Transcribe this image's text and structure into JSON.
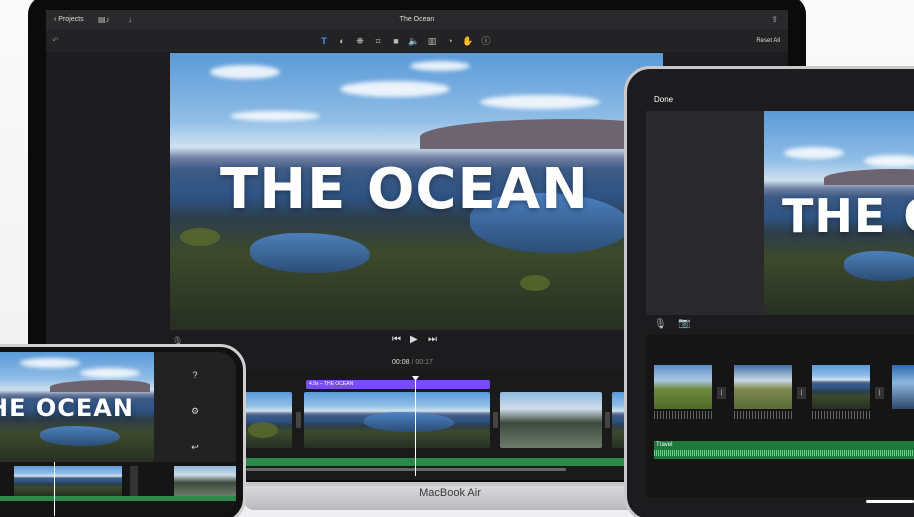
{
  "mac": {
    "back_label": "Projects",
    "project_title": "The Ocean",
    "reset_label": "Reset All",
    "video_title": "THE OCEAN",
    "current_time": "00:08",
    "separator": "/",
    "duration": "00:17",
    "clip_label": "4.9s – THE OCEAN",
    "device_label": "MacBook Air",
    "tools": [
      "title-tool",
      "color-tool",
      "filter-tool",
      "crop-tool",
      "stabilize-tool",
      "volume-tool",
      "equalizer-tool",
      "speed-tool",
      "noise-tool",
      "info-tool"
    ],
    "toolbar_glyphs": [
      "T",
      "◐",
      "❋",
      "⌗",
      "■",
      "🔈",
      "▥",
      "◔",
      "✋",
      "ⓘ"
    ]
  },
  "ipad": {
    "done_label": "Done",
    "video_title": "THE O",
    "audio_track_label": "Travel"
  },
  "iphone": {
    "video_title": "HE OCEAN",
    "side_buttons": [
      "?",
      "⚙",
      "↩"
    ]
  }
}
